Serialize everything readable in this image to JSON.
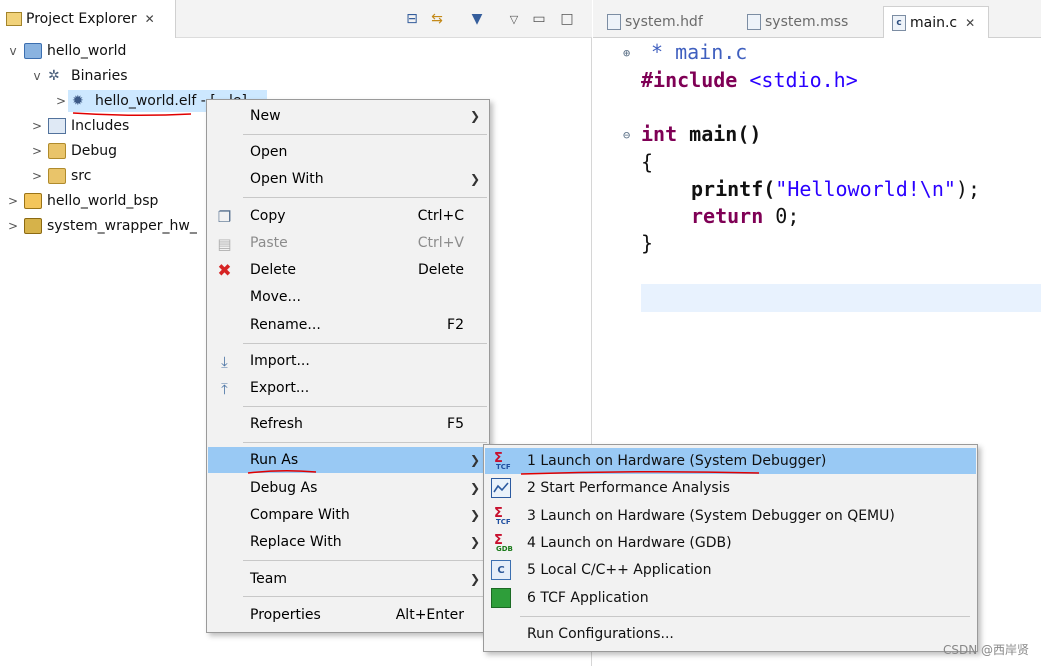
{
  "explorer": {
    "tab_title": "Project Explorer",
    "tree": [
      {
        "label": "hello_world",
        "depth": 0,
        "expand": "v"
      },
      {
        "label": "Binaries",
        "depth": 1,
        "expand": "v"
      },
      {
        "label": "hello_world.elf - [...le]",
        "depth": 2,
        "expand": ">"
      },
      {
        "label": "Includes",
        "depth": 1,
        "expand": ">"
      },
      {
        "label": "Debug",
        "depth": 1,
        "expand": ">"
      },
      {
        "label": "src",
        "depth": 1,
        "expand": ">"
      },
      {
        "label": "hello_world_bsp",
        "depth": 0,
        "expand": ">"
      },
      {
        "label": "system_wrapper_hw_",
        "depth": 0,
        "expand": ">"
      }
    ]
  },
  "editor": {
    "tabs": [
      {
        "label": "system.hdf"
      },
      {
        "label": "system.mss"
      },
      {
        "label": "main.c"
      }
    ],
    "code": {
      "l1_comment": "* main.c",
      "l2_kw": "#include",
      "l2_path": "<stdio.h>",
      "l3_kw": "int",
      "l3_rest": " main()",
      "l4": "{",
      "l5_fn": "printf(",
      "l5_str": "\"Helloworld!\\n\"",
      "l5_end": ");",
      "l6_kw": "return",
      "l6_rest": " 0;",
      "l7": "}"
    }
  },
  "context_menu": {
    "items": [
      {
        "label": "New",
        "accel": "",
        "submenu": true
      },
      {
        "label": "Open",
        "accel": "",
        "submenu": false
      },
      {
        "label": "Open With",
        "accel": "",
        "submenu": true
      },
      {
        "label": "Copy",
        "accel": "Ctrl+C",
        "submenu": false
      },
      {
        "label": "Paste",
        "accel": "Ctrl+V",
        "submenu": false
      },
      {
        "label": "Delete",
        "accel": "Delete",
        "submenu": false
      },
      {
        "label": "Move...",
        "accel": "",
        "submenu": false
      },
      {
        "label": "Rename...",
        "accel": "F2",
        "submenu": false
      },
      {
        "label": "Import...",
        "accel": "",
        "submenu": false
      },
      {
        "label": "Export...",
        "accel": "",
        "submenu": false
      },
      {
        "label": "Refresh",
        "accel": "F5",
        "submenu": false
      },
      {
        "label": "Run As",
        "accel": "",
        "submenu": true
      },
      {
        "label": "Debug As",
        "accel": "",
        "submenu": true
      },
      {
        "label": "Compare With",
        "accel": "",
        "submenu": true
      },
      {
        "label": "Replace With",
        "accel": "",
        "submenu": true
      },
      {
        "label": "Team",
        "accel": "",
        "submenu": true
      },
      {
        "label": "Properties",
        "accel": "Alt+Enter",
        "submenu": false
      }
    ]
  },
  "run_as_submenu": {
    "items": [
      {
        "label": "1 Launch on Hardware (System Debugger)"
      },
      {
        "label": "2 Start Performance Analysis"
      },
      {
        "label": "3 Launch on Hardware (System Debugger on QEMU)"
      },
      {
        "label": "4 Launch on Hardware (GDB)"
      },
      {
        "label": "5 Local C/C++ Application"
      },
      {
        "label": "6 TCF Application"
      },
      {
        "label": "Run Configurations..."
      }
    ]
  },
  "icons": {
    "close": "close-x-icon",
    "delete": "red-x-icon",
    "copy": "copy-icon",
    "paste": "paste-icon"
  },
  "colors": {
    "menu_highlight": "#99c9f4",
    "selection": "#cde8ff",
    "annotation_red": "#e00000"
  },
  "watermark": "CSDN @西岸贤"
}
